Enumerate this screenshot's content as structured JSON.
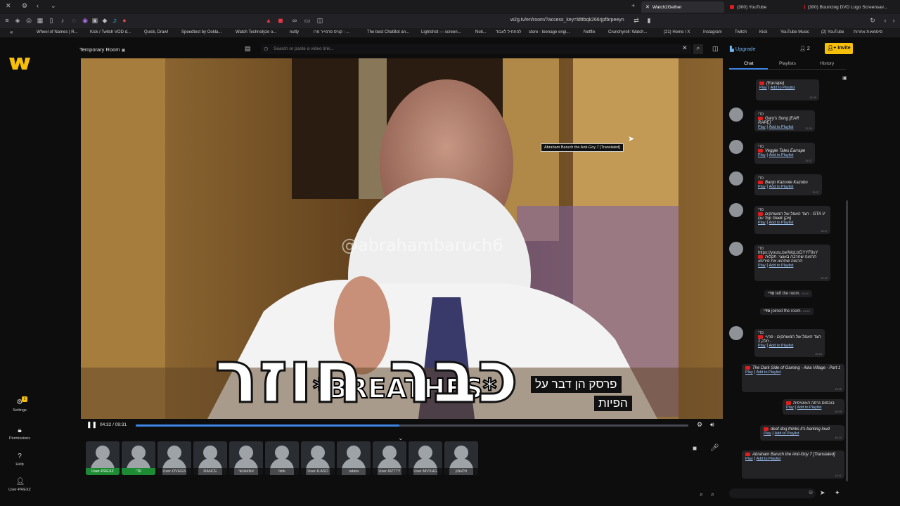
{
  "browser": {
    "tabs": [
      {
        "label": "Watch2Gether",
        "active": true
      },
      {
        "label": "(300) YouTube",
        "active": false
      },
      {
        "label": "(300) Bouncing DVD Logo Screensav...",
        "active": false
      }
    ],
    "url": "w2g.tv/en/room/?access_key=ldttbqk266rjpfbrpeeyn",
    "bookmarks": [
      "Wheel of Names | R...",
      "Kick / Twitch VOD d...",
      "Quick, Draw!",
      "Speedtest by Ookla...",
      "Watch Technolyze o...",
      "nutty",
      "קורס פרמייר פרו - ...",
      "The best ChatBot an...",
      "Lightshot — screen...",
      "Noti...",
      "להתחיל לעבוד",
      "store - teenage engi...",
      "Netflix",
      "Crunchyroll: Watch...",
      "(21) Home / X",
      "Instagram",
      "Twitch",
      "Kick",
      "YouTube Music",
      "(2) YouTube",
      "סיסמאות אחרות"
    ]
  },
  "sidebar": {
    "settings_label": "Settings",
    "settings_badge": "1",
    "permissions_label": "Permissions",
    "help_label": "Help",
    "user_label": "User-PREXZ"
  },
  "room": {
    "title": "Temporary Room",
    "search_placeholder": "Search or paste a video link..."
  },
  "video": {
    "watermark": "@abrahambaruch6",
    "caption_big": "כבר חוזר",
    "caption_breathes": "*BREATHES*",
    "caption_hebrew_1": "פרסק הן דבר על",
    "caption_hebrew_2": "הפיות",
    "tooltip": "Abraham Baruch the Anti-Goy 7 [Translated]",
    "time_current": "04:32",
    "time_total": "09:31",
    "time_display": "04:32 / 09:31",
    "progress": 0.477
  },
  "users": [
    "User-PREXZ",
    "סדי",
    "User-OVHGS",
    "RANCE",
    "אמאאנשי",
    "Itzik",
    "User-ILASD",
    "ratata",
    "User-NZTTY",
    "User-MVXHG",
    "פלאמון"
  ],
  "panel": {
    "upgrade_label": "Upgrade",
    "user_count": "2",
    "invite_label": "Invite",
    "tabs": [
      "Chat",
      "Playlists",
      "History"
    ],
    "play_label": "Play",
    "add_label": "Add to Playlist",
    "messages": [
      {
        "title": "(Earrape)",
        "time": "15:36"
      },
      {
        "name": "סדי",
        "title": "Gary's Song [EAR RAPE]",
        "time": "15:36"
      },
      {
        "name": "סדי",
        "title": "Veggie Tales Earrape",
        "time": "15:37"
      },
      {
        "name": "סדי",
        "title": "Banjo Kazooie Kazobo",
        "time": "15:37"
      },
      {
        "name": "סדי",
        "title": "הצד האפל של המשחקים - GTA V עם Top Geek (ווק)",
        "time": "15:37"
      },
      {
        "name": "סדי",
        "url": "https://youtu.be/WqUzDYYF9sY",
        "title": "הרגעה שחרבה באגצי: תקלות הרגצה שתהעו את פירזנא",
        "time": "15:40"
      },
      {
        "system": "left the room.",
        "user": "סדי",
        "time": "15:40"
      },
      {
        "system": "joined the room.",
        "user": "סדי",
        "time": "15:42"
      },
      {
        "name": "סדי",
        "title": "הצד האפל של המשחקים - פרויי - חלק 1",
        "time": "15:46"
      },
      {
        "title": "The Dark Side of Gaming - Aika Village - Part 1",
        "time": "16:06"
      },
      {
        "title": "בובסוס גרסה האוטיסית",
        "time": "16:09"
      },
      {
        "title": "deaf dog thinks it's barking loud",
        "time": "16:10"
      },
      {
        "title": "Abraham Baruch the Anti-Goy 7 [Translated]",
        "time": "16:11"
      }
    ]
  },
  "colors": {
    "accent": "#f5bf0a",
    "progress": "#3d86e6",
    "youtube": "#e01e1e",
    "green_user": "#1d8a34"
  }
}
